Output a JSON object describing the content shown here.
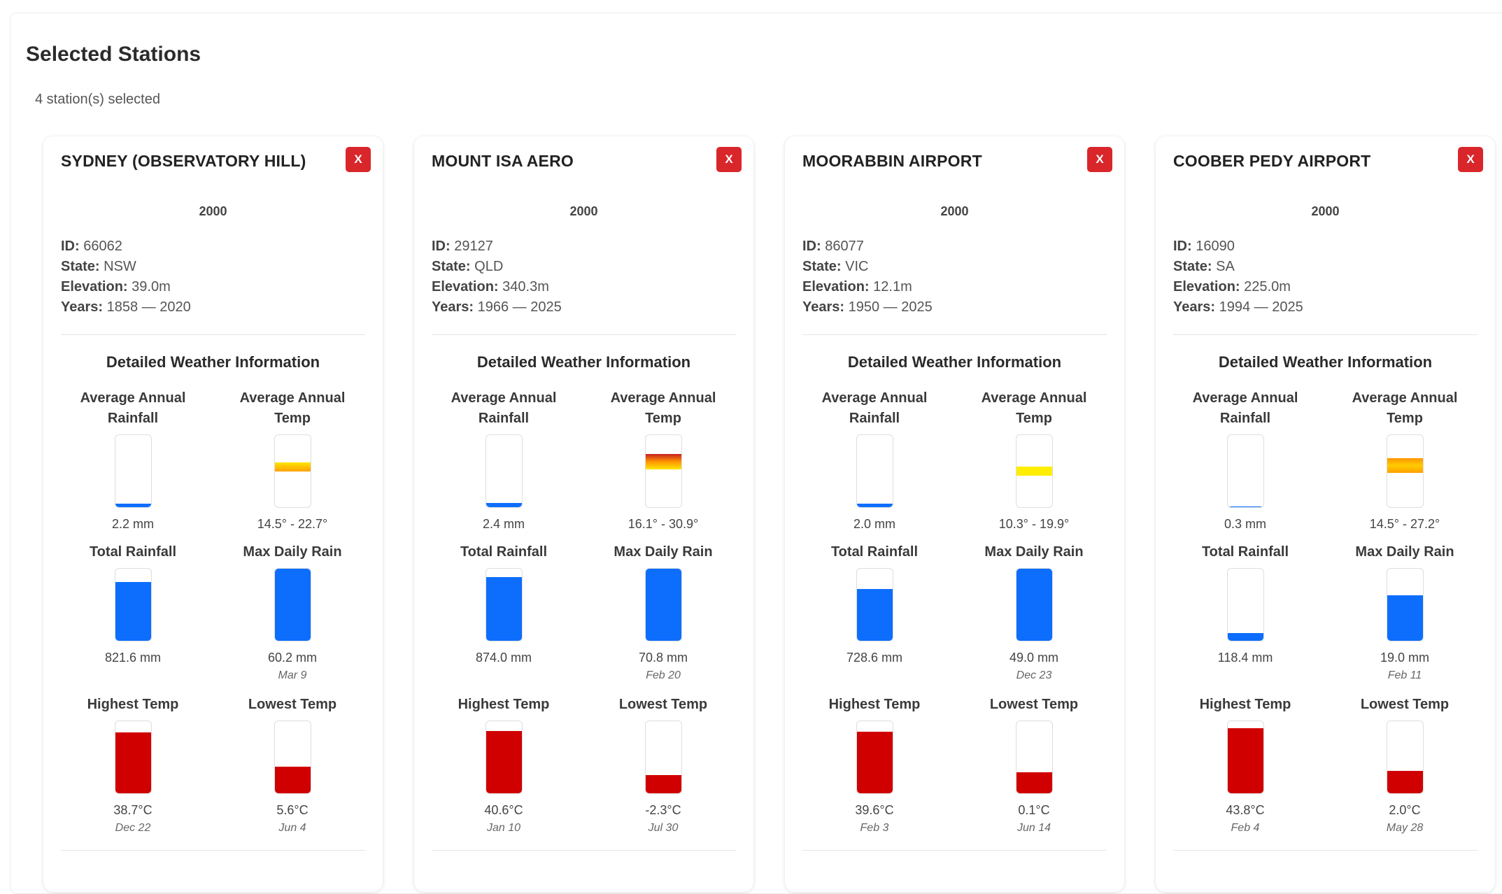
{
  "panel": {
    "title": "Selected Stations",
    "count_text": "4 station(s) selected"
  },
  "labels": {
    "id": "ID:",
    "state": "State:",
    "elevation": "Elevation:",
    "years": "Years:",
    "detail_title": "Detailed Weather Information",
    "avg_rainfall_l1": "Average Annual",
    "avg_rainfall_l2": "Rainfall",
    "avg_temp_l1": "Average Annual",
    "avg_temp_l2": "Temp",
    "total_rainfall": "Total Rainfall",
    "max_daily_rain": "Max Daily Rain",
    "highest_temp": "Highest Temp",
    "lowest_temp": "Lowest Temp",
    "remove": "X"
  },
  "colors": {
    "rain": "#0d6efd",
    "temp_max": "#d10000",
    "remove_button": "#d9262b"
  },
  "stations": [
    {
      "name": "SYDNEY (OBSERVATORY HILL)",
      "year": "2000",
      "id": "66062",
      "state": "NSW",
      "elevation": "39.0m",
      "years": "1858 — 2020",
      "avg_rainfall": {
        "value": "2.2 mm",
        "fill_fraction": 0.05
      },
      "avg_temp": {
        "value": "14.5° - 22.7°",
        "band_low_fraction": 0.5,
        "band_high_fraction": 0.62,
        "gradient": [
          "#ffa000",
          "#ffe600"
        ]
      },
      "total_rainfall": {
        "value": "821.6 mm",
        "fill_fraction": 0.82
      },
      "max_daily_rain": {
        "value": "60.2 mm",
        "date": "Mar 9",
        "fill_fraction": 1.0
      },
      "highest_temp": {
        "value": "38.7°C",
        "date": "Dec 22",
        "fill_fraction": 0.84
      },
      "lowest_temp": {
        "value": "5.6°C",
        "date": "Jun 4",
        "fill_fraction": 0.37
      }
    },
    {
      "name": "MOUNT ISA AERO",
      "year": "2000",
      "id": "29127",
      "state": "QLD",
      "elevation": "340.3m",
      "years": "1966 — 2025",
      "avg_rainfall": {
        "value": "2.4 mm",
        "fill_fraction": 0.06
      },
      "avg_temp": {
        "value": "16.1° - 30.9°",
        "band_low_fraction": 0.52,
        "band_high_fraction": 0.74,
        "gradient": [
          "#ffe600",
          "#ff9500",
          "#c62020"
        ]
      },
      "total_rainfall": {
        "value": "874.0 mm",
        "fill_fraction": 0.88
      },
      "max_daily_rain": {
        "value": "70.8 mm",
        "date": "Feb 20",
        "fill_fraction": 1.0
      },
      "highest_temp": {
        "value": "40.6°C",
        "date": "Jan 10",
        "fill_fraction": 0.86
      },
      "lowest_temp": {
        "value": "-2.3°C",
        "date": "Jul 30",
        "fill_fraction": 0.25
      }
    },
    {
      "name": "MOORABBIN AIRPORT",
      "year": "2000",
      "id": "86077",
      "state": "VIC",
      "elevation": "12.1m",
      "years": "1950 — 2025",
      "avg_rainfall": {
        "value": "2.0 mm",
        "fill_fraction": 0.05
      },
      "avg_temp": {
        "value": "10.3° - 19.9°",
        "band_low_fraction": 0.44,
        "band_high_fraction": 0.56,
        "gradient": [
          "#ffee00",
          "#ffee00"
        ]
      },
      "total_rainfall": {
        "value": "728.6 mm",
        "fill_fraction": 0.72
      },
      "max_daily_rain": {
        "value": "49.0 mm",
        "date": "Dec 23",
        "fill_fraction": 1.0
      },
      "highest_temp": {
        "value": "39.6°C",
        "date": "Feb 3",
        "fill_fraction": 0.85
      },
      "lowest_temp": {
        "value": "0.1°C",
        "date": "Jun 14",
        "fill_fraction": 0.29
      }
    },
    {
      "name": "COOBER PEDY AIRPORT",
      "year": "2000",
      "id": "16090",
      "state": "SA",
      "elevation": "225.0m",
      "years": "1994 — 2025",
      "avg_rainfall": {
        "value": "0.3 mm",
        "fill_fraction": 0.01
      },
      "avg_temp": {
        "value": "14.5° - 27.2°",
        "band_low_fraction": 0.48,
        "band_high_fraction": 0.68,
        "gradient": [
          "#ffa000",
          "#ffcc00",
          "#ff9500"
        ]
      },
      "total_rainfall": {
        "value": "118.4 mm",
        "fill_fraction": 0.11
      },
      "max_daily_rain": {
        "value": "19.0 mm",
        "date": "Feb 11",
        "fill_fraction": 0.63
      },
      "highest_temp": {
        "value": "43.8°C",
        "date": "Feb 4",
        "fill_fraction": 0.9
      },
      "lowest_temp": {
        "value": "2.0°C",
        "date": "May 28",
        "fill_fraction": 0.31
      }
    }
  ]
}
